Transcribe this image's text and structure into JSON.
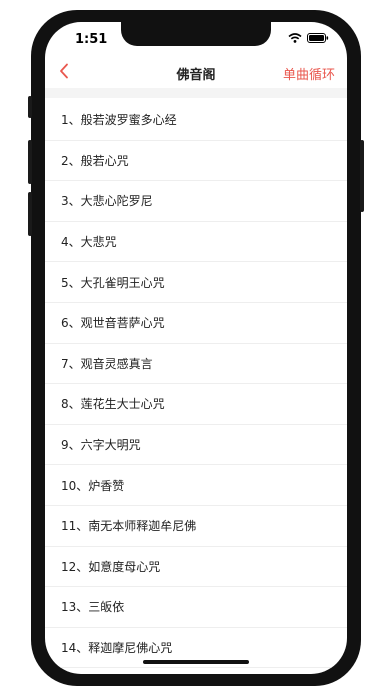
{
  "status": {
    "time": "1:51"
  },
  "nav": {
    "title": "佛音阁",
    "loop_label": "单曲循环"
  },
  "colors": {
    "accent": "#e9574e"
  },
  "list": [
    "1、般若波罗蜜多心经",
    "2、般若心咒",
    "3、大悲心陀罗尼",
    "4、大悲咒",
    "5、大孔雀明王心咒",
    "6、观世音菩萨心咒",
    "7、观音灵感真言",
    "8、莲花生大士心咒",
    "9、六字大明咒",
    "10、炉香赞",
    "11、南无本师释迦牟尼佛",
    "12、如意度母心咒",
    "13、三皈依",
    "14、释迦摩尼佛心咒"
  ]
}
